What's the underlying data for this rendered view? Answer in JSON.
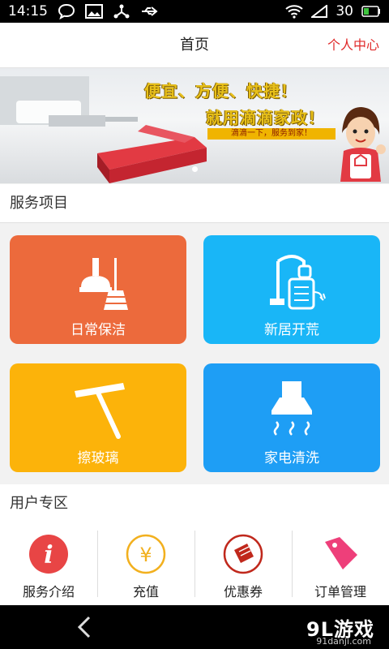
{
  "status_bar": {
    "time": "14:15",
    "battery": "30",
    "icons": [
      "chat-bubble-icon",
      "image-icon",
      "usb-share-icon",
      "usb-icon",
      "wifi-icon",
      "battery-icon"
    ]
  },
  "header": {
    "title": "首页",
    "profile_link": "个人中心"
  },
  "banner": {
    "slogan_line1": "便宜、方便、快捷！",
    "slogan_line2": "就用滴滴家政！",
    "slogan_line3": "滴滴一下，服务到家！"
  },
  "services": {
    "title": "服务项目",
    "items": [
      {
        "label": "日常保洁",
        "color": "#ec6a3c",
        "icon": "cleaning-tools-icon"
      },
      {
        "label": "新居开荒",
        "color": "#19b6f7",
        "icon": "vacuum-cleaner-icon"
      },
      {
        "label": "擦玻璃",
        "color": "#fcb30a",
        "icon": "squeegee-icon"
      },
      {
        "label": "家电清洗",
        "color": "#1e9ef5",
        "icon": "range-hood-icon"
      }
    ]
  },
  "user_zone": {
    "title": "用户专区",
    "items": [
      {
        "label": "服务介绍",
        "icon": "info-icon",
        "color": "#e84545"
      },
      {
        "label": "充值",
        "icon": "yen-icon",
        "color": "#f2b01e"
      },
      {
        "label": "优惠券",
        "icon": "ticket-icon",
        "color": "#c0281c"
      },
      {
        "label": "订单管理",
        "icon": "price-tag-icon",
        "color": "#ee3f7a"
      }
    ]
  },
  "symbols": {
    "info": "i",
    "yen": "¥"
  },
  "watermark": {
    "brand": "9L游戏",
    "url": "91danji.com"
  }
}
